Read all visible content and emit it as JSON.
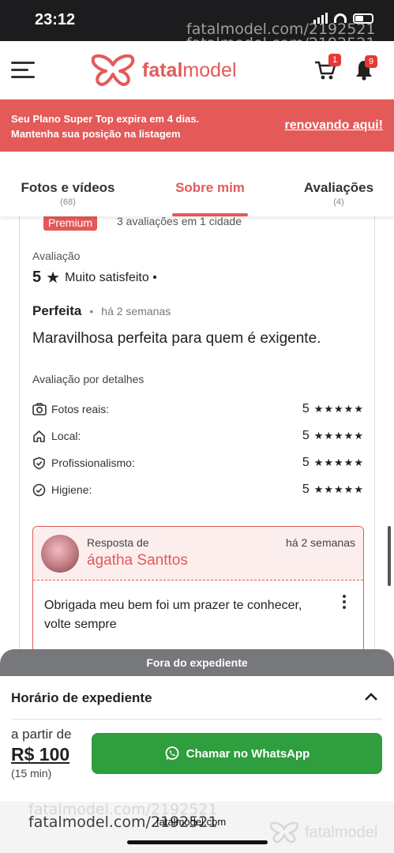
{
  "status": {
    "time": "23:12"
  },
  "watermark": "fatalmodel.com/2192521",
  "header": {
    "logo_bold": "fatal",
    "logo_rest": "model",
    "cart_count": "1",
    "notif_count": "9"
  },
  "banner": {
    "line1": "Seu Plano Super Top expira em 4 dias.",
    "line2": "Mantenha sua posição na listagem",
    "link": "renovando aqui!"
  },
  "tabs": [
    {
      "label": "Fotos e vídeos",
      "count": "(68)"
    },
    {
      "label": "Sobre mim",
      "count": ""
    },
    {
      "label": "Avaliações",
      "count": "(4)"
    }
  ],
  "review": {
    "badge": "Premium",
    "summary": "3 avaliações em 1 cidade",
    "label": "Avaliação",
    "score": "5",
    "score_text": "Muito satisfeito •",
    "title": "Perfeita",
    "when": "há 2 semanas",
    "body": "Maravilhosa perfeita para quem é exigente.",
    "details_title": "Avaliação por detalhes",
    "details": [
      {
        "name": "Fotos reais:",
        "value": "5",
        "stars": "★★★★★"
      },
      {
        "name": "Local:",
        "value": "5",
        "stars": "★★★★★"
      },
      {
        "name": "Profissionalismo:",
        "value": "5",
        "stars": "★★★★★"
      },
      {
        "name": "Higiene:",
        "value": "5",
        "stars": "★★★★★"
      }
    ],
    "reply": {
      "label": "Resposta de",
      "name": "ágatha Santtos",
      "when": "há 2 semanas",
      "body": "Obrigada meu bem foi um prazer te conhecer, volte sempre"
    }
  },
  "sheet": {
    "pill": "Fora do expediente",
    "title": "Horário de expediente",
    "from": "a partir de",
    "price": "R$ 100",
    "duration": "(15 min)",
    "whatsapp": "Chamar no WhatsApp"
  },
  "footer": {
    "url": "fatalmodel.com",
    "logo": "fatalmodel"
  },
  "colors": {
    "brand": "#e35a59",
    "whatsapp": "#2e9e3e"
  }
}
